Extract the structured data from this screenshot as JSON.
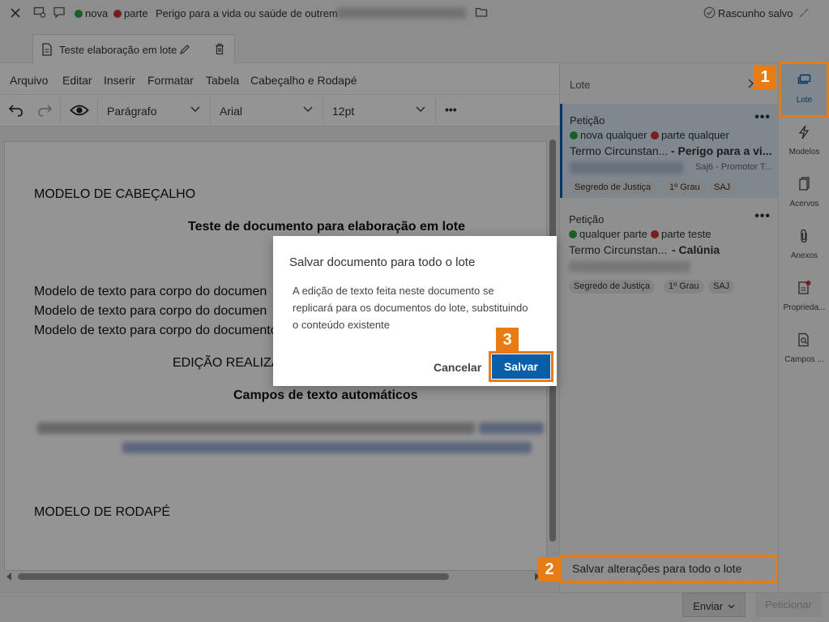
{
  "topbar": {
    "nova_label": "nova",
    "parte_label": "parte",
    "title": "Perigo para a vida ou saúde de outrem",
    "draft_status": "Rascunho salvo"
  },
  "tab": {
    "label": "Teste elaboração em lote"
  },
  "menu": [
    "Arquivo",
    "Editar",
    "Inserir",
    "Formatar",
    "Tabela",
    "Cabeçalho e Rodapé"
  ],
  "toolbar": {
    "style": "Parágrafo",
    "font": "Arial",
    "size": "12pt",
    "more": "•••"
  },
  "document": {
    "header": "MODELO DE CABEÇALHO",
    "title": "Teste de documento para elaboração em lote",
    "line1": "Modelo de texto para corpo do documen",
    "line2": "Modelo de texto para corpo do documen",
    "line3": "Modelo de texto para corpo do documento",
    "edicao": "EDIÇÃO REALIZA",
    "campos": "Campos de texto automáticos",
    "footer": "MODELO DE RODAPÉ"
  },
  "lote": {
    "header": "Lote",
    "cards": [
      {
        "type": "Petição",
        "nova": "nova qualquer",
        "parte": "parte qualquer",
        "termo": "Termo Circunstan...",
        "crime": "- Perigo para a vi...",
        "sub": "Saj6 - Promotor T...",
        "tags": [
          "Segredo de Justiça",
          "1º Grau",
          "SAJ"
        ]
      },
      {
        "type": "Petição",
        "nova": "qualquer parte",
        "parte": "parte teste",
        "termo": "Termo Circunstan...",
        "crime": "- Calúnia",
        "tags": [
          "Segredo de Justiça",
          "1º Grau",
          "SAJ"
        ]
      }
    ],
    "save_all": "Salvar alterações para todo o lote"
  },
  "nav": [
    "Lote",
    "Modelos",
    "Acervos",
    "Anexos",
    "Proprieda...",
    "Campos ..."
  ],
  "bottom": {
    "send": "Enviar",
    "petition": "Peticionar"
  },
  "modal": {
    "title": "Salvar documento para todo o lote",
    "body": "A edição de texto feita neste documento se replicará para os documentos do lote, substituindo o conteúdo existente",
    "cancel": "Cancelar",
    "save": "Salvar"
  },
  "callouts": [
    "1",
    "2",
    "3"
  ],
  "colors": {
    "accent": "#e87c14",
    "primary": "#0a5ea8",
    "nova": "#2ea043",
    "parte": "#d13438"
  }
}
